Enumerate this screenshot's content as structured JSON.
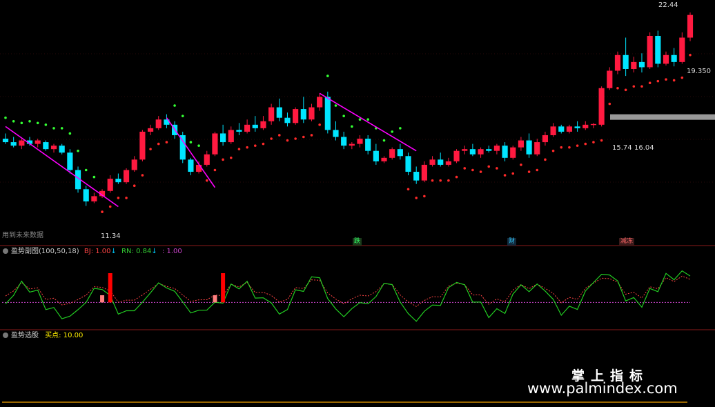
{
  "chart_data": {
    "type": "candlestick",
    "y_range_main": [
      9.5,
      23.0
    ],
    "candles": [
      {
        "o": 15.2,
        "h": 15.5,
        "l": 14.9,
        "c": 15.0,
        "up": false
      },
      {
        "o": 15.0,
        "h": 15.3,
        "l": 14.7,
        "c": 14.8,
        "up": false
      },
      {
        "o": 14.8,
        "h": 15.2,
        "l": 14.6,
        "c": 15.1,
        "up": true
      },
      {
        "o": 15.1,
        "h": 15.3,
        "l": 14.8,
        "c": 14.9,
        "up": false
      },
      {
        "o": 14.9,
        "h": 15.2,
        "l": 14.7,
        "c": 15.1,
        "up": true
      },
      {
        "o": 15.0,
        "h": 15.1,
        "l": 14.5,
        "c": 14.6,
        "up": false
      },
      {
        "o": 14.6,
        "h": 14.9,
        "l": 14.4,
        "c": 14.8,
        "up": true
      },
      {
        "o": 14.8,
        "h": 14.9,
        "l": 14.3,
        "c": 14.4,
        "up": false
      },
      {
        "o": 14.4,
        "h": 14.6,
        "l": 13.2,
        "c": 13.4,
        "up": false
      },
      {
        "o": 13.4,
        "h": 13.6,
        "l": 12.1,
        "c": 12.3,
        "up": false
      },
      {
        "o": 12.3,
        "h": 12.5,
        "l": 11.34,
        "c": 11.6,
        "up": false
      },
      {
        "o": 11.6,
        "h": 12.1,
        "l": 11.5,
        "c": 11.9,
        "up": true
      },
      {
        "o": 11.9,
        "h": 12.3,
        "l": 11.8,
        "c": 12.2,
        "up": true
      },
      {
        "o": 12.2,
        "h": 13.1,
        "l": 12.1,
        "c": 12.9,
        "up": true
      },
      {
        "o": 12.9,
        "h": 13.2,
        "l": 12.6,
        "c": 12.7,
        "up": false
      },
      {
        "o": 12.7,
        "h": 13.5,
        "l": 12.6,
        "c": 13.4,
        "up": true
      },
      {
        "o": 13.4,
        "h": 14.2,
        "l": 13.3,
        "c": 14.0,
        "up": true
      },
      {
        "o": 14.0,
        "h": 15.7,
        "l": 13.9,
        "c": 15.6,
        "up": true
      },
      {
        "o": 15.6,
        "h": 16.0,
        "l": 15.4,
        "c": 15.8,
        "up": true
      },
      {
        "o": 15.8,
        "h": 16.5,
        "l": 15.7,
        "c": 16.3,
        "up": true
      },
      {
        "o": 16.3,
        "h": 16.6,
        "l": 15.8,
        "c": 16.0,
        "up": false
      },
      {
        "o": 16.0,
        "h": 16.2,
        "l": 15.2,
        "c": 15.4,
        "up": false
      },
      {
        "o": 15.4,
        "h": 15.6,
        "l": 13.8,
        "c": 14.0,
        "up": false
      },
      {
        "o": 14.0,
        "h": 14.1,
        "l": 13.1,
        "c": 13.3,
        "up": false
      },
      {
        "o": 13.3,
        "h": 13.9,
        "l": 13.2,
        "c": 13.7,
        "up": true
      },
      {
        "o": 13.7,
        "h": 14.5,
        "l": 13.6,
        "c": 14.3,
        "up": true
      },
      {
        "o": 14.3,
        "h": 15.6,
        "l": 14.2,
        "c": 15.5,
        "up": true
      },
      {
        "o": 15.5,
        "h": 16.0,
        "l": 14.8,
        "c": 15.0,
        "up": false
      },
      {
        "o": 15.0,
        "h": 15.9,
        "l": 14.9,
        "c": 15.7,
        "up": true
      },
      {
        "o": 15.7,
        "h": 16.1,
        "l": 15.4,
        "c": 15.6,
        "up": false
      },
      {
        "o": 15.6,
        "h": 16.3,
        "l": 15.5,
        "c": 16.0,
        "up": true
      },
      {
        "o": 16.0,
        "h": 16.5,
        "l": 15.6,
        "c": 15.8,
        "up": false
      },
      {
        "o": 15.8,
        "h": 16.5,
        "l": 15.7,
        "c": 16.2,
        "up": true
      },
      {
        "o": 16.2,
        "h": 17.2,
        "l": 16.0,
        "c": 17.0,
        "up": true
      },
      {
        "o": 17.0,
        "h": 17.5,
        "l": 16.2,
        "c": 16.4,
        "up": false
      },
      {
        "o": 16.4,
        "h": 16.7,
        "l": 15.9,
        "c": 16.1,
        "up": false
      },
      {
        "o": 16.1,
        "h": 17.0,
        "l": 16.0,
        "c": 16.9,
        "up": true
      },
      {
        "o": 16.9,
        "h": 17.6,
        "l": 16.1,
        "c": 16.3,
        "up": false
      },
      {
        "o": 16.3,
        "h": 17.2,
        "l": 16.2,
        "c": 17.0,
        "up": true
      },
      {
        "o": 17.0,
        "h": 17.8,
        "l": 16.8,
        "c": 17.6,
        "up": true
      },
      {
        "o": 17.6,
        "h": 17.9,
        "l": 15.5,
        "c": 15.7,
        "up": false
      },
      {
        "o": 15.7,
        "h": 16.2,
        "l": 15.1,
        "c": 15.3,
        "up": false
      },
      {
        "o": 15.3,
        "h": 15.6,
        "l": 14.6,
        "c": 14.8,
        "up": false
      },
      {
        "o": 14.8,
        "h": 15.0,
        "l": 14.6,
        "c": 14.9,
        "up": true
      },
      {
        "o": 14.9,
        "h": 15.4,
        "l": 14.7,
        "c": 15.2,
        "up": true
      },
      {
        "o": 15.2,
        "h": 15.4,
        "l": 14.3,
        "c": 14.5,
        "up": false
      },
      {
        "o": 14.5,
        "h": 14.9,
        "l": 13.7,
        "c": 13.9,
        "up": false
      },
      {
        "o": 13.9,
        "h": 14.2,
        "l": 13.8,
        "c": 14.1,
        "up": true
      },
      {
        "o": 14.1,
        "h": 14.7,
        "l": 14.0,
        "c": 14.6,
        "up": true
      },
      {
        "o": 14.6,
        "h": 14.9,
        "l": 14.0,
        "c": 14.2,
        "up": false
      },
      {
        "o": 14.2,
        "h": 14.4,
        "l": 13.1,
        "c": 13.3,
        "up": false
      },
      {
        "o": 13.3,
        "h": 13.6,
        "l": 12.6,
        "c": 12.8,
        "up": false
      },
      {
        "o": 12.8,
        "h": 13.9,
        "l": 12.7,
        "c": 13.7,
        "up": true
      },
      {
        "o": 13.7,
        "h": 14.2,
        "l": 13.6,
        "c": 14.0,
        "up": true
      },
      {
        "o": 14.0,
        "h": 14.4,
        "l": 13.6,
        "c": 13.7,
        "up": false
      },
      {
        "o": 13.7,
        "h": 14.1,
        "l": 13.6,
        "c": 13.9,
        "up": true
      },
      {
        "o": 13.9,
        "h": 14.6,
        "l": 13.8,
        "c": 14.5,
        "up": true
      },
      {
        "o": 14.5,
        "h": 14.8,
        "l": 14.3,
        "c": 14.6,
        "up": true
      },
      {
        "o": 14.6,
        "h": 14.9,
        "l": 14.2,
        "c": 14.3,
        "up": false
      },
      {
        "o": 14.3,
        "h": 14.7,
        "l": 14.1,
        "c": 14.6,
        "up": true
      },
      {
        "o": 14.6,
        "h": 14.8,
        "l": 14.4,
        "c": 14.5,
        "up": false
      },
      {
        "o": 14.5,
        "h": 14.9,
        "l": 14.3,
        "c": 14.8,
        "up": true
      },
      {
        "o": 14.8,
        "h": 15.0,
        "l": 13.9,
        "c": 14.1,
        "up": false
      },
      {
        "o": 14.1,
        "h": 14.8,
        "l": 14.0,
        "c": 14.7,
        "up": true
      },
      {
        "o": 14.7,
        "h": 15.3,
        "l": 14.5,
        "c": 15.1,
        "up": true
      },
      {
        "o": 15.1,
        "h": 15.5,
        "l": 14.1,
        "c": 14.3,
        "up": false
      },
      {
        "o": 14.3,
        "h": 15.2,
        "l": 14.2,
        "c": 15.0,
        "up": true
      },
      {
        "o": 15.0,
        "h": 15.6,
        "l": 14.8,
        "c": 15.4,
        "up": true
      },
      {
        "o": 15.4,
        "h": 16.1,
        "l": 15.3,
        "c": 15.9,
        "up": true
      },
      {
        "o": 15.9,
        "h": 16.0,
        "l": 15.5,
        "c": 15.6,
        "up": false
      },
      {
        "o": 15.6,
        "h": 16.0,
        "l": 15.5,
        "c": 15.9,
        "up": true
      },
      {
        "o": 15.9,
        "h": 16.2,
        "l": 15.6,
        "c": 15.8,
        "up": false
      },
      {
        "o": 15.8,
        "h": 16.2,
        "l": 15.7,
        "c": 16.0,
        "up": true
      },
      {
        "o": 16.0,
        "h": 16.1,
        "l": 15.8,
        "c": 16.04,
        "up": true
      },
      {
        "o": 16.0,
        "h": 18.2,
        "l": 15.9,
        "c": 18.1,
        "up": true
      },
      {
        "o": 18.1,
        "h": 19.3,
        "l": 18.0,
        "c": 19.1,
        "up": true
      },
      {
        "o": 19.1,
        "h": 20.2,
        "l": 18.9,
        "c": 20.0,
        "up": true
      },
      {
        "o": 20.0,
        "h": 21.0,
        "l": 18.8,
        "c": 19.2,
        "up": false
      },
      {
        "o": 19.2,
        "h": 19.9,
        "l": 19.0,
        "c": 19.6,
        "up": true
      },
      {
        "o": 19.6,
        "h": 20.1,
        "l": 19.0,
        "c": 19.3,
        "up": false
      },
      {
        "o": 19.3,
        "h": 21.3,
        "l": 19.2,
        "c": 21.1,
        "up": true
      },
      {
        "o": 21.1,
        "h": 21.4,
        "l": 19.3,
        "c": 19.5,
        "up": false
      },
      {
        "o": 19.5,
        "h": 20.2,
        "l": 19.4,
        "c": 20.0,
        "up": true
      },
      {
        "o": 20.0,
        "h": 20.4,
        "l": 19.35,
        "c": 19.6,
        "up": false
      },
      {
        "o": 19.6,
        "h": 21.3,
        "l": 19.5,
        "c": 21.0,
        "up": true
      },
      {
        "o": 21.0,
        "h": 22.44,
        "l": 20.8,
        "c": 22.3,
        "up": true
      }
    ],
    "price_labels": {
      "low": "11.34",
      "high": "22.44",
      "last_low": "19.350",
      "zone_left": "15.74",
      "zone_right": "16.04"
    },
    "sub_indicator": {
      "title": "盈势副图(100,50,18)",
      "bj_label": "BJ: 1.00",
      "rn_label": "RN: 0.84",
      "third_label": ": 1.00",
      "y_range": [
        0,
        1.2
      ]
    },
    "selector_indicator": {
      "title": "盈势选股",
      "buy_label": "买点: 10.00"
    }
  },
  "labels": {
    "future_data": "用到未来数据",
    "event_1": "跌",
    "event_2": "财",
    "event_3": "减冻"
  },
  "watermark": {
    "line1": "掌上指标",
    "line2": "www.palmindex.com"
  },
  "colors": {
    "up": "#ff1a40",
    "down": "#00e5ff",
    "trend": "#ff00ff",
    "dot_support": "#ff2a2a",
    "dot_resist": "#33ff33",
    "rn_line": "#22cc22",
    "bj_line": "#ff4444"
  }
}
